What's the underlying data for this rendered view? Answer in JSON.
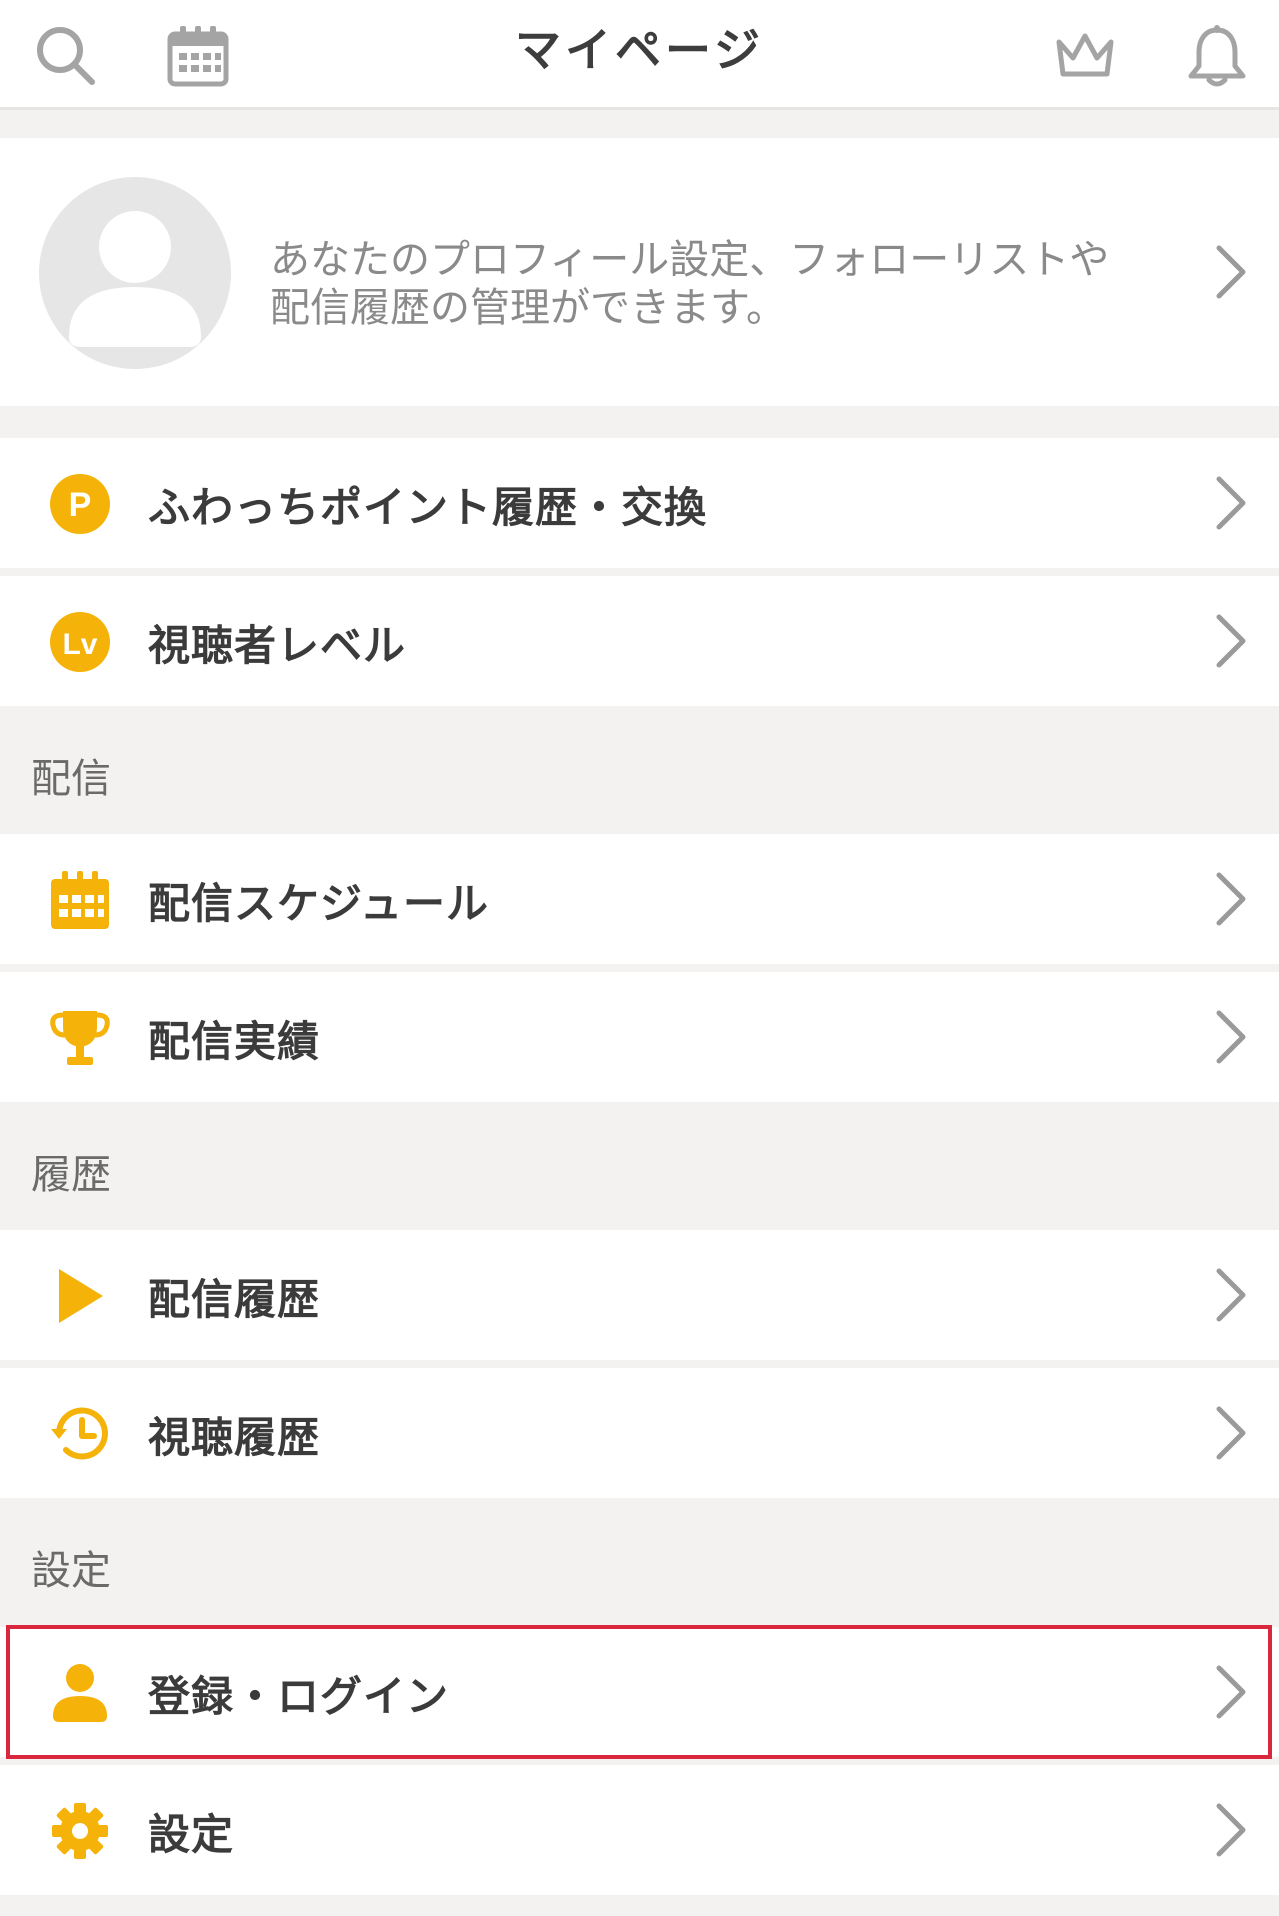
{
  "header": {
    "title": "マイページ",
    "icons": [
      "search-icon",
      "calendar-icon",
      "crown-icon",
      "bell-icon"
    ]
  },
  "profile": {
    "description_line1": "あなたのプロフィール設定、フォローリストや",
    "description_line2": "配信履歴の管理ができます。"
  },
  "colors": {
    "accent": "#f5b30a",
    "highlight": "#d9283e",
    "background": "#f3f2f0",
    "section_text": "#6a6a6a",
    "chevron": "#9a9a9a"
  },
  "menu": {
    "points": {
      "label": "ふわっちポイント履歴・交換",
      "badge": "P"
    },
    "level": {
      "label": "視聴者レベル",
      "badge": "Lv"
    }
  },
  "sections": {
    "broadcast": {
      "title": "配信",
      "items": [
        {
          "label": "配信スケジュール",
          "icon": "calendar-icon"
        },
        {
          "label": "配信実績",
          "icon": "trophy-icon"
        }
      ]
    },
    "history": {
      "title": "履歴",
      "items": [
        {
          "label": "配信履歴",
          "icon": "play-icon"
        },
        {
          "label": "視聴履歴",
          "icon": "history-icon"
        }
      ]
    },
    "settings": {
      "title": "設定",
      "items": [
        {
          "label": "登録・ログイン",
          "icon": "user-icon"
        },
        {
          "label": "設定",
          "icon": "gear-icon"
        }
      ]
    }
  }
}
